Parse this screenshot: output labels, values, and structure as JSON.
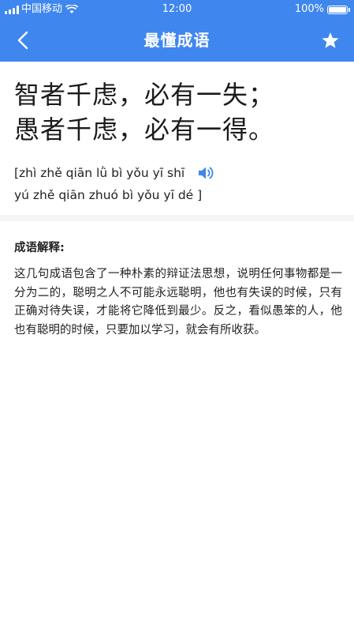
{
  "status_bar": {
    "carrier": "中国移动",
    "time": "12:00",
    "battery": "100%"
  },
  "nav": {
    "back_icon": "chevron-left-icon",
    "title": "最懂成语",
    "favorite_icon": "star-icon"
  },
  "idiom": {
    "line1": "智者千虑，必有一失；",
    "line2": "愚者千虑，必有一得。"
  },
  "pinyin": {
    "line1": "[zhì zhě qiān lǜ bì yǒu yī shī",
    "line2": "yú zhě qiān zhuó bì yǒu yī dé ]",
    "speaker_icon": "speaker-icon"
  },
  "explanation": {
    "heading": "成语解释:",
    "text": "这几句成语包含了一种朴素的辩证法思想，说明任何事物都是一分为二的，聪明之人不可能永远聪明，他也有失误的时候，只有正确对待失误，才能将它降低到最少。反之，看似愚笨的人，他也有聪明的时候，只要加以学习，就会有所收获。"
  },
  "colors": {
    "primary": "#3f87ee",
    "speaker": "#3f87ee",
    "divider": "#f5f5f5"
  }
}
